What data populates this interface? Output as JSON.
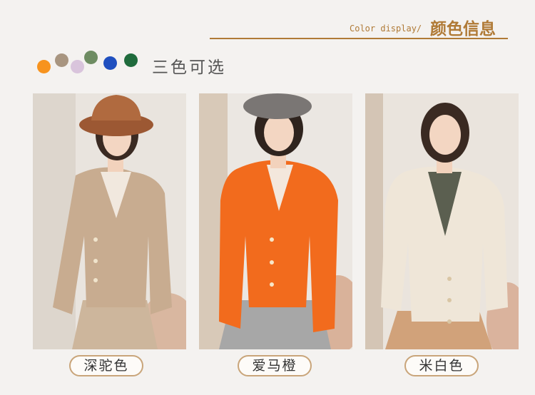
{
  "header": {
    "en": "Color display/",
    "cn": "颜色信息",
    "accent_color": "#b07a36"
  },
  "palette": {
    "label": "三色可选",
    "swatches": [
      "#f7931e",
      "#a89580",
      "#d9c4dc",
      "#6e8c62",
      "#1f4fbf",
      "#1f6b3c"
    ]
  },
  "products": [
    {
      "color_name": "深驼色",
      "sweater_color": "#c8ac90"
    },
    {
      "color_name": "爱马橙",
      "sweater_color": "#f26b1d"
    },
    {
      "color_name": "米白色",
      "sweater_color": "#efe6d8"
    }
  ]
}
